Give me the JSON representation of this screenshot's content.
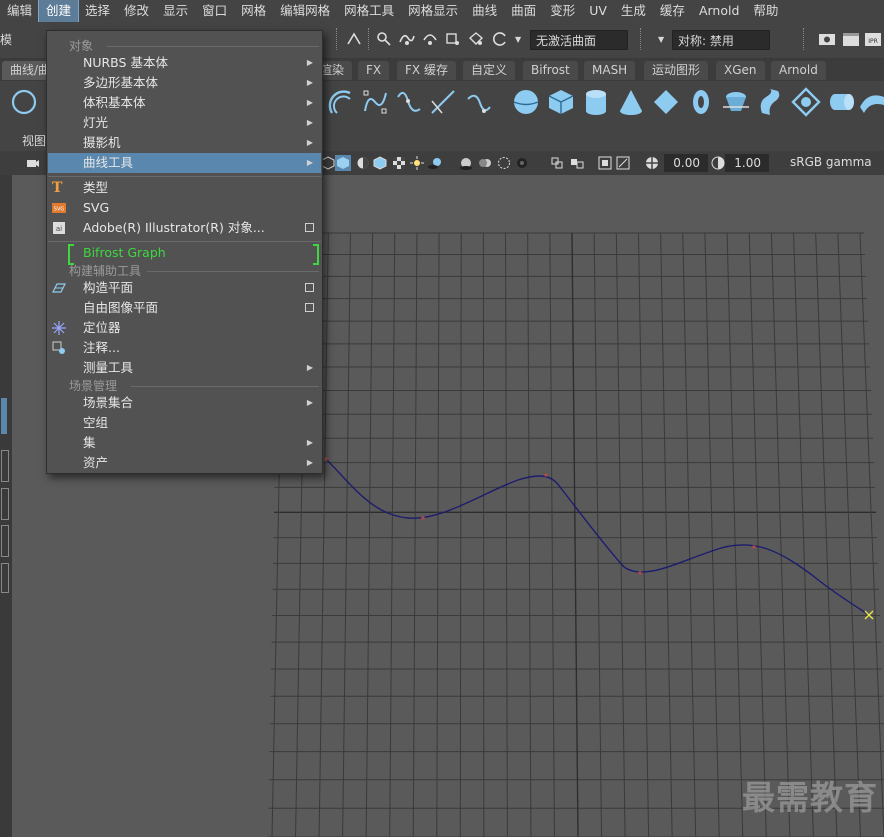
{
  "menubar": {
    "items": [
      "编辑",
      "创建",
      "选择",
      "修改",
      "显示",
      "窗口",
      "网格",
      "编辑网格",
      "网格工具",
      "网格显示",
      "曲线",
      "曲面",
      "变形",
      "UV",
      "生成",
      "缓存",
      "Arnold",
      "帮助"
    ],
    "active_index": 1
  },
  "statusline": {
    "mode_fragment": "模",
    "live_surface": "无激活曲面",
    "symmetry": "对称: 禁用"
  },
  "shelf": {
    "tabs": [
      "曲线/曲",
      "渲染",
      "FX",
      "FX 缓存",
      "自定义",
      "Bifrost",
      "MASH",
      "运动图形",
      "XGen",
      "Arnold"
    ]
  },
  "panel": {
    "view_label": "视图",
    "exposure": "0.00",
    "gamma": "1.00",
    "color_space": "sRGB gamma",
    "toggle_badge": "ON"
  },
  "create_menu": {
    "section_objects": "对象",
    "nurbs": "NURBS 基本体",
    "polygon": "多边形基本体",
    "volume": "体积基本体",
    "lights": "灯光",
    "cameras": "摄影机",
    "curve_tools": "曲线工具",
    "type": "类型",
    "svg": "SVG",
    "illustrator": "Adobe(R) Illustrator(R) 对象...",
    "bifrost": "Bifrost Graph",
    "section_construction": "构建辅助工具",
    "construction_plane": "构造平面",
    "free_image_plane": "自由图像平面",
    "locator": "定位器",
    "annotation": "注释...",
    "measure_tools": "测量工具",
    "section_scene": "场景管理",
    "scene_assembly": "场景集合",
    "empty_group": "空组",
    "sets": "集",
    "assets": "资产"
  },
  "watermark": "最需教育",
  "colors": {
    "highlight": "#5a87ad",
    "bifrost_green": "#3ed83e",
    "curve": "#1d1d6e",
    "grid": "#3a3a3a"
  }
}
